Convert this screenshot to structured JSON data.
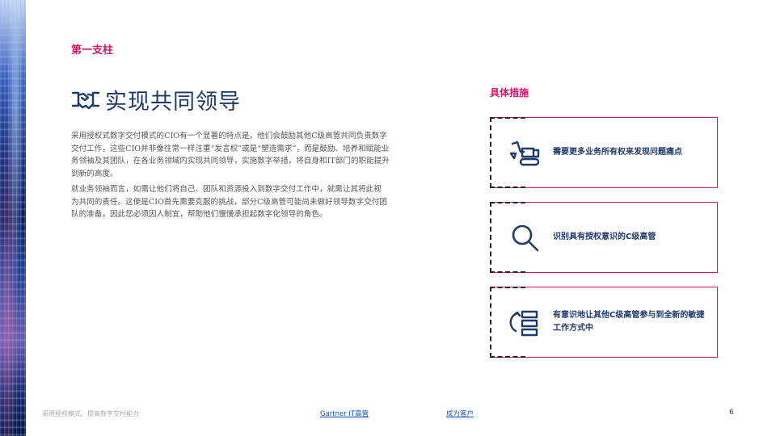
{
  "section_label": "第一支柱",
  "heading": {
    "title": "实现共同领导",
    "icon": "handshake-icon"
  },
  "body": {
    "paragraph1": "采用授权式数字交付模式的CIO有一个显著的特点是，他们会鼓励其他C级高管共同负责数字交付工作，这些CIO并非像往常一样注重“发言权”或是“塑造需求”，而是鼓励、培养和赋能业务领袖及其团队，在各业务领域内实现共同领导，实施数字举措，将自身和IT部门的职能提升到新的高度。",
    "paragraph2": "就业务领袖而言，如需让他们将自己、团队和资源投入到数字交付工作中，就需让其将此视为共同的责任。这便是CIO首先需要克服的挑战，部分C级高管可能尚未做好领导数字交付团队的准备，因此您必须因人制宜，帮助他们慢慢承担起数字化领导的角色。"
  },
  "measures": {
    "label": "具体措施",
    "cards": [
      {
        "icon": "excavator-icon",
        "text": "需要更多业务所有权来发现问题痛点"
      },
      {
        "icon": "magnifier-icon",
        "text": "识别具有授权意识的C级高管"
      },
      {
        "icon": "cycle-list-icon",
        "text": "有意识地让其他C级高管参与到全新的敏捷工作方式中"
      }
    ]
  },
  "footer": {
    "left_text": "采用授权模式，提高数字交付能力",
    "link1": "Gartner IT高管",
    "link2": "成为客户",
    "page_number": "6"
  },
  "colors": {
    "accent": "#d6186c",
    "navy": "#1f3a68",
    "link": "#1a55b8"
  }
}
